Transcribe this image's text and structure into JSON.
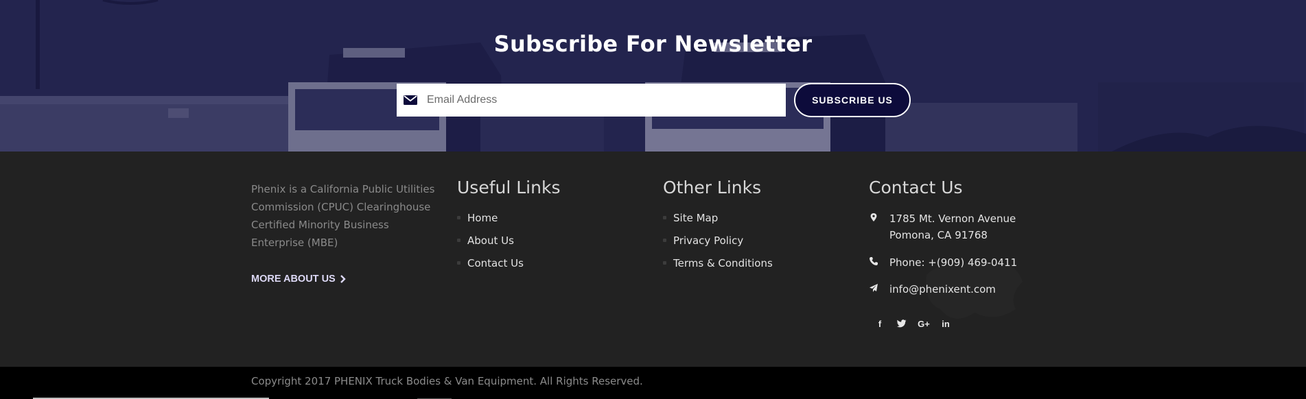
{
  "newsletter": {
    "title": "Subscribe For Newsletter",
    "email_placeholder": "Email Address",
    "email_value": "",
    "subscribe_label": "SUBSCRIBE US",
    "mail_icon": "envelope-icon"
  },
  "about": {
    "text": "Phenix is a California Public Utilities Commission (CPUC) Clearinghouse Certified Minority Business Enterprise (MBE)",
    "more_label": "MORE ABOUT US",
    "more_icon": "chevron-right-icon"
  },
  "useful_links": {
    "title": "Useful Links",
    "items": [
      "Home",
      "About Us",
      "Contact Us"
    ]
  },
  "other_links": {
    "title": "Other Links",
    "items": [
      "Site Map",
      "Privacy Policy",
      "Terms & Conditions"
    ]
  },
  "contact": {
    "title": "Contact Us",
    "address_line1": "1785 Mt. Vernon Avenue",
    "address_line2": "Pomona, CA 91768",
    "phone": "Phone: +(909) 469-0411",
    "email": "info@phenixent.com",
    "icons": [
      "map-marker-icon",
      "phone-icon",
      "paper-plane-icon"
    ]
  },
  "social": {
    "facebook": "f",
    "twitter": "twitter-icon",
    "google_plus": "G+",
    "linkedin": "in"
  },
  "copyright": "Copyright 2017 PHENIX Truck Bodies & Van Equipment. All Rights Reserved.",
  "colors": {
    "hero_overlay": "#16164a",
    "footer_bg": "#222222",
    "bottom_bar": "#000000",
    "button_bg": "#0d0b3b",
    "accent_link": "#dcd8f5"
  }
}
